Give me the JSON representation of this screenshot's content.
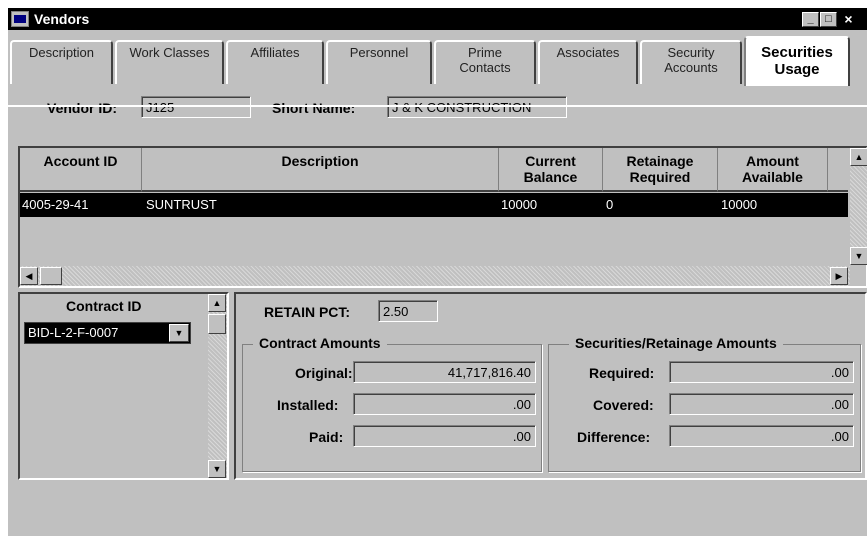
{
  "window": {
    "title": "Vendors",
    "controls": {
      "minimize": "_",
      "maximize": "□",
      "close": "×"
    }
  },
  "tabs": [
    {
      "label": "Description"
    },
    {
      "label": "Work Classes"
    },
    {
      "label": "Affiliates"
    },
    {
      "label": "Personnel"
    },
    {
      "label": "Prime\nContacts"
    },
    {
      "label": "Associates"
    },
    {
      "label": "Security\nAccounts"
    },
    {
      "label": "Securities\nUsage",
      "active": true
    }
  ],
  "vendor": {
    "vendor_id_label": "Vendor ID:",
    "vendor_id": "J125",
    "short_name_label": "Short Name:",
    "short_name": "J & K CONSTRUCTION"
  },
  "accounts_table": {
    "columns": [
      "Account ID",
      "Description",
      "Current\nBalance",
      "Retainage\nRequired",
      "Amount\nAvailable"
    ],
    "rows": [
      {
        "account_id": "4005-29-41",
        "description": "SUNTRUST",
        "current_balance": "10000",
        "retainage_required": "0",
        "amount_available": "10000"
      }
    ]
  },
  "contract": {
    "header": "Contract ID",
    "selected": "BID-L-2-F-0007"
  },
  "retain": {
    "label": "RETAIN PCT:",
    "value": "2.50"
  },
  "contract_amounts": {
    "title": "Contract Amounts",
    "original_label": "Original:",
    "original": "41,717,816.40",
    "installed_label": "Installed:",
    "installed": ".00",
    "paid_label": "Paid:",
    "paid": ".00"
  },
  "securities_amounts": {
    "title": "Securities/Retainage Amounts",
    "required_label": "Required:",
    "required": ".00",
    "covered_label": "Covered:",
    "covered": ".00",
    "difference_label": "Difference:",
    "difference": ".00"
  },
  "icons": {
    "app": "vendor-window-icon",
    "scroll_up": "▲",
    "scroll_down": "▼",
    "scroll_left": "◀",
    "scroll_right": "▶",
    "dropdown": "▼"
  }
}
